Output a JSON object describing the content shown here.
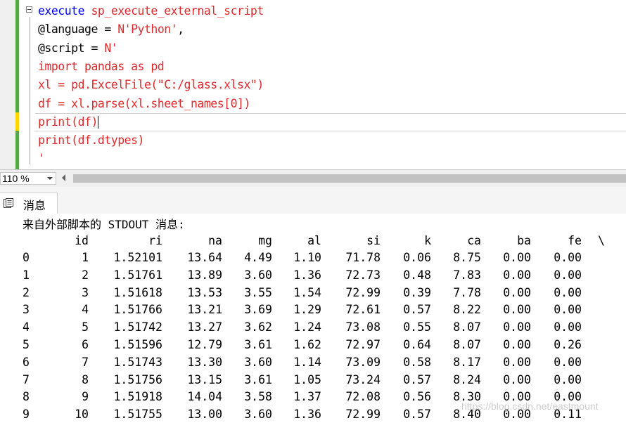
{
  "editor": {
    "lines": [
      [
        {
          "t": "execute",
          "c": "kw"
        },
        {
          "t": " sp_execute_external_script",
          "c": "str"
        }
      ],
      [
        {
          "t": "@language",
          "c": "nm"
        },
        {
          "t": " = ",
          "c": "nm"
        },
        {
          "t": "N'Python'",
          "c": "str"
        },
        {
          "t": ",",
          "c": "nm"
        }
      ],
      [
        {
          "t": "@script",
          "c": "nm"
        },
        {
          "t": " = ",
          "c": "nm"
        },
        {
          "t": "N'",
          "c": "str"
        }
      ],
      [
        {
          "t": "import pandas as pd",
          "c": "str"
        }
      ],
      [
        {
          "t": "xl = pd.ExcelFile(\"C:/glass.xlsx\")",
          "c": "str"
        }
      ],
      [
        {
          "t": "df = xl.parse(xl.sheet_names[0])",
          "c": "str"
        }
      ],
      [
        {
          "t": "print(df)",
          "c": "str"
        }
      ],
      [
        {
          "t": "print(df.dtypes)",
          "c": "str"
        }
      ],
      [
        {
          "t": "'",
          "c": "str"
        }
      ]
    ]
  },
  "zoom": {
    "value": "110 %"
  },
  "results_tab": {
    "label": "消息"
  },
  "stdout_header": "来自外部脚本的 STDOUT 消息:",
  "table": {
    "columns": [
      "id",
      "ri",
      "na",
      "mg",
      "al",
      "si",
      "k",
      "ca",
      "ba",
      "fe",
      "\\"
    ],
    "rows": [
      {
        "index": "0",
        "values": [
          "1",
          "1.52101",
          "13.64",
          "4.49",
          "1.10",
          "71.78",
          "0.06",
          "8.75",
          "0.00",
          "0.00"
        ]
      },
      {
        "index": "1",
        "values": [
          "2",
          "1.51761",
          "13.89",
          "3.60",
          "1.36",
          "72.73",
          "0.48",
          "7.83",
          "0.00",
          "0.00"
        ]
      },
      {
        "index": "2",
        "values": [
          "3",
          "1.51618",
          "13.53",
          "3.55",
          "1.54",
          "72.99",
          "0.39",
          "7.78",
          "0.00",
          "0.00"
        ]
      },
      {
        "index": "3",
        "values": [
          "4",
          "1.51766",
          "13.21",
          "3.69",
          "1.29",
          "72.61",
          "0.57",
          "8.22",
          "0.00",
          "0.00"
        ]
      },
      {
        "index": "4",
        "values": [
          "5",
          "1.51742",
          "13.27",
          "3.62",
          "1.24",
          "73.08",
          "0.55",
          "8.07",
          "0.00",
          "0.00"
        ]
      },
      {
        "index": "5",
        "values": [
          "6",
          "1.51596",
          "12.79",
          "3.61",
          "1.62",
          "72.97",
          "0.64",
          "8.07",
          "0.00",
          "0.26"
        ]
      },
      {
        "index": "6",
        "values": [
          "7",
          "1.51743",
          "13.30",
          "3.60",
          "1.14",
          "73.09",
          "0.58",
          "8.17",
          "0.00",
          "0.00"
        ]
      },
      {
        "index": "7",
        "values": [
          "8",
          "1.51756",
          "13.15",
          "3.61",
          "1.05",
          "73.24",
          "0.57",
          "8.24",
          "0.00",
          "0.00"
        ]
      },
      {
        "index": "8",
        "values": [
          "9",
          "1.51918",
          "14.04",
          "3.58",
          "1.37",
          "72.08",
          "0.56",
          "8.30",
          "0.00",
          "0.00"
        ]
      },
      {
        "index": "9",
        "values": [
          "10",
          "1.51755",
          "13.00",
          "3.60",
          "1.36",
          "72.99",
          "0.57",
          "8.40",
          "0.00",
          "0.11"
        ]
      }
    ]
  },
  "watermark": "https://blog.csdn.net/eastmount",
  "colors": {
    "keyword": "#0000ff",
    "string": "#e0292d",
    "changed_margin": "#57a64a",
    "unsaved_margin": "#ffd800"
  },
  "icons": {
    "collapse": "collapse-minus-icon",
    "messages": "messages-icon",
    "zoom_dropdown": "chevron-down-icon",
    "scroll_left": "scroll-left-arrow-icon"
  }
}
